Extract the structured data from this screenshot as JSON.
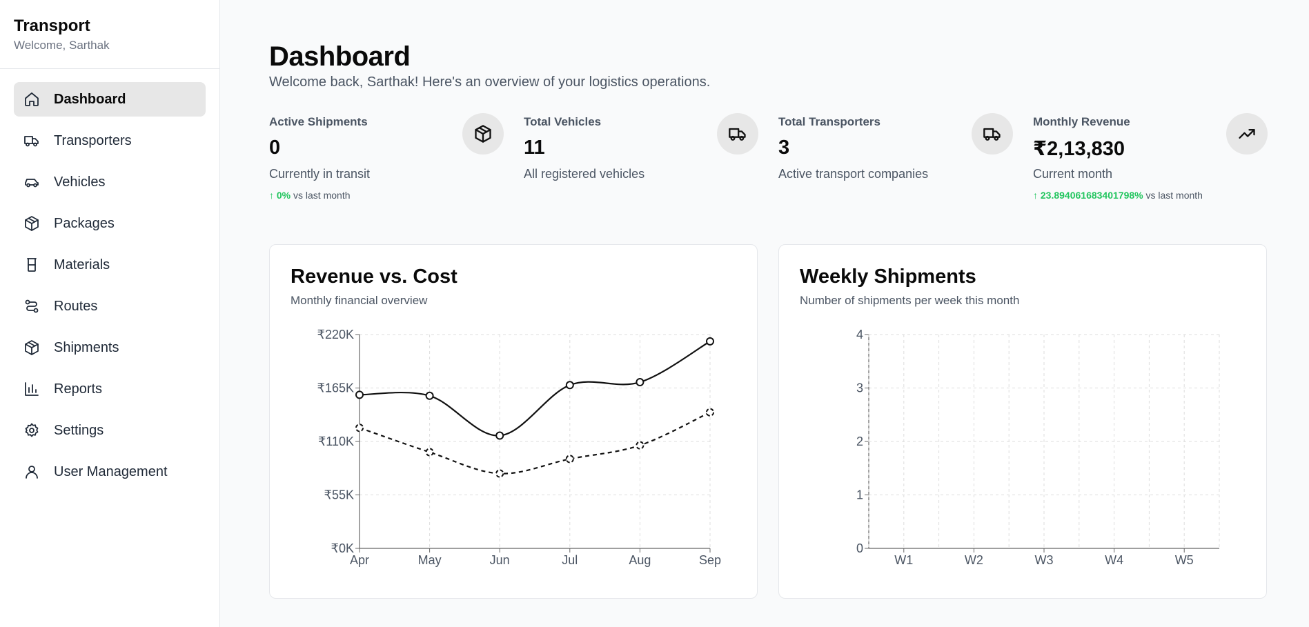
{
  "sidebar": {
    "title": "Transport",
    "subtitle": "Welcome, Sarthak",
    "items": [
      {
        "label": "Dashboard",
        "icon": "home-icon",
        "active": true
      },
      {
        "label": "Transporters",
        "icon": "truck-icon"
      },
      {
        "label": "Vehicles",
        "icon": "car-icon"
      },
      {
        "label": "Packages",
        "icon": "package-icon"
      },
      {
        "label": "Materials",
        "icon": "flask-icon"
      },
      {
        "label": "Routes",
        "icon": "route-icon"
      },
      {
        "label": "Shipments",
        "icon": "package-icon"
      },
      {
        "label": "Reports",
        "icon": "bar-chart-icon"
      },
      {
        "label": "Settings",
        "icon": "gear-icon"
      },
      {
        "label": "User Management",
        "icon": "user-icon"
      }
    ]
  },
  "header": {
    "title": "Dashboard",
    "subtitle": "Welcome back, Sarthak! Here's an overview of your logistics operations."
  },
  "stats": [
    {
      "label": "Active Shipments",
      "value": "0",
      "desc": "Currently in transit",
      "trend_value": "↑ 0%",
      "trend_suffix": "vs last month",
      "icon": "package-icon"
    },
    {
      "label": "Total Vehicles",
      "value": "11",
      "desc": "All registered vehicles",
      "icon": "truck-icon"
    },
    {
      "label": "Total Transporters",
      "value": "3",
      "desc": "Active transport companies",
      "icon": "truck-icon"
    },
    {
      "label": "Monthly Revenue",
      "value": "₹2,13,830",
      "desc": "Current month",
      "trend_value": "↑ 23.894061683401798%",
      "trend_suffix": "vs last month",
      "icon": "trending-up-icon"
    }
  ],
  "colors": {
    "accent_green": "#22c55e",
    "line": "#111111",
    "grid": "#dddddd"
  },
  "charts": {
    "revenue": {
      "title": "Revenue vs. Cost",
      "subtitle": "Monthly financial overview"
    },
    "weekly": {
      "title": "Weekly Shipments",
      "subtitle": "Number of shipments per week this month"
    }
  },
  "chart_data": [
    {
      "type": "line",
      "title": "Revenue vs. Cost",
      "x": [
        "Apr",
        "May",
        "Jun",
        "Jul",
        "Aug",
        "Sep"
      ],
      "y_ticks": [
        "₹0K",
        "₹55K",
        "₹110K",
        "₹165K",
        "₹220K"
      ],
      "ylim": [
        0,
        220
      ],
      "series": [
        {
          "values": [
            158,
            157,
            116,
            168,
            171,
            213
          ],
          "style": "solid"
        },
        {
          "values": [
            124,
            99,
            77,
            92,
            106,
            140
          ],
          "style": "dashed"
        }
      ],
      "grid": true
    },
    {
      "type": "bar",
      "title": "Weekly Shipments",
      "categories": [
        "W1",
        "W2",
        "W3",
        "W4",
        "W5"
      ],
      "values": [
        0,
        0,
        0,
        0,
        0
      ],
      "y_ticks": [
        "0",
        "1",
        "2",
        "3",
        "4"
      ],
      "ylim": [
        0,
        4
      ],
      "grid": true
    }
  ]
}
